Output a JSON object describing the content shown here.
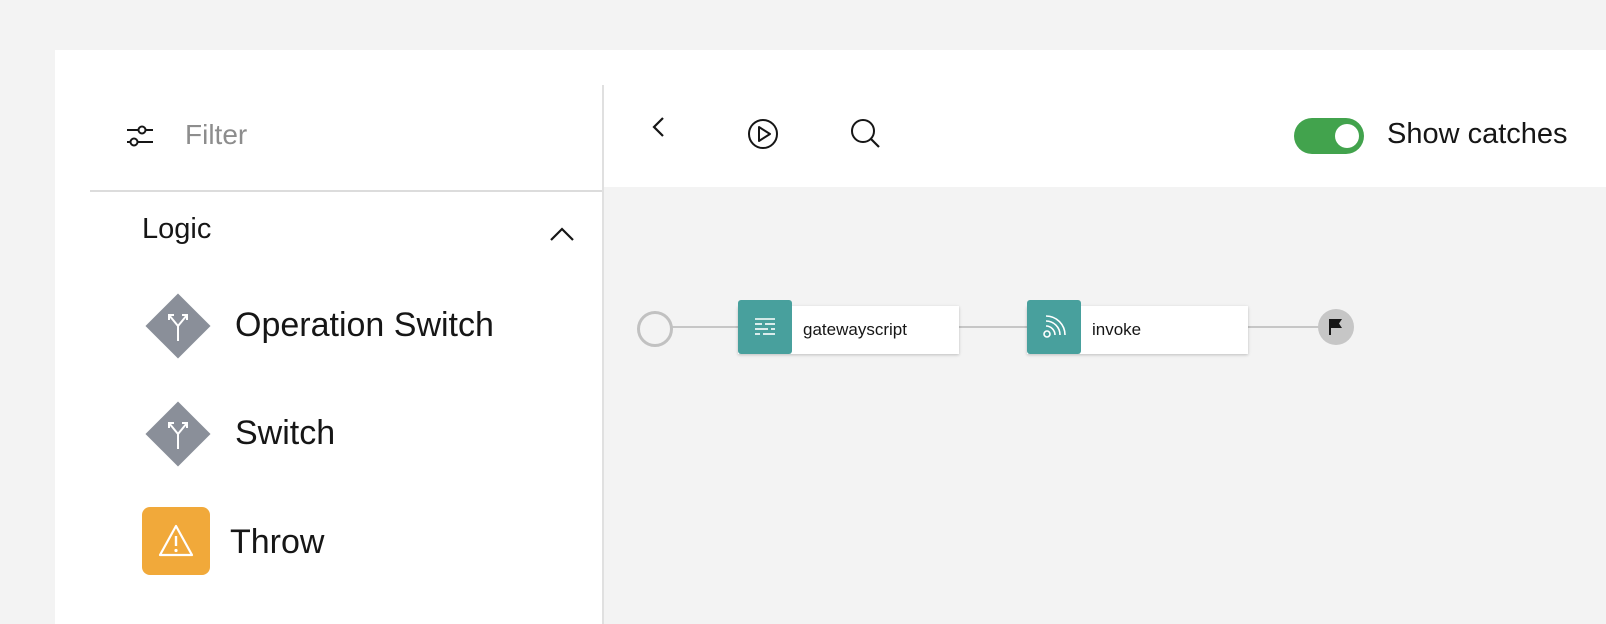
{
  "palette": {
    "filter": {
      "placeholder": "Filter",
      "value": ""
    },
    "category": {
      "label": "Logic",
      "expanded": true
    },
    "items": [
      {
        "label": "Operation Switch",
        "icon": "switch-branch-icon",
        "color": "#8a8f99"
      },
      {
        "label": "Switch",
        "icon": "switch-branch-icon",
        "color": "#8a8f99"
      },
      {
        "label": "Throw",
        "icon": "warning-icon",
        "color": "#f1a93a"
      }
    ]
  },
  "toolbar": {
    "buttons": [
      "back-icon",
      "play-icon",
      "search-icon"
    ],
    "show_catches": {
      "label": "Show catches",
      "enabled": true,
      "color": "#42a34d"
    }
  },
  "flow": {
    "nodes": [
      {
        "label": "gatewayscript",
        "icon": "gatewayscript-icon",
        "color": "#48a09d"
      },
      {
        "label": "invoke",
        "icon": "invoke-icon",
        "color": "#48a09d"
      }
    ],
    "start": "start-circle",
    "end": "end-flag"
  }
}
